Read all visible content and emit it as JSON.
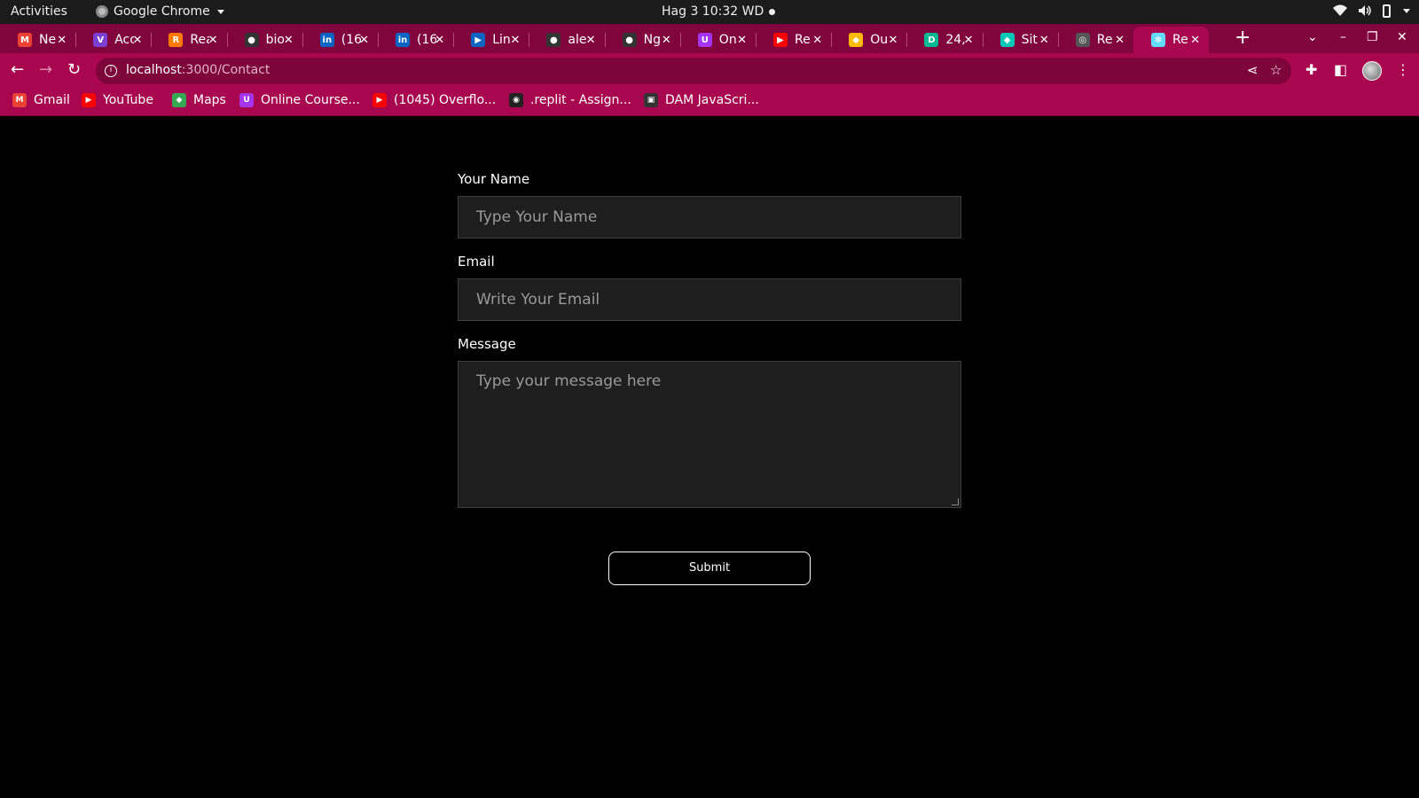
{
  "system_bar": {
    "activities": "Activities",
    "app_name": "Google Chrome",
    "clock": "Hag 3  10:32 WD"
  },
  "browser": {
    "tabs": [
      {
        "title": "Ne",
        "favicon": "gmail-icon",
        "color": "#ea4335",
        "glyph": "M"
      },
      {
        "title": "Acc",
        "favicon": "visual-studio-icon",
        "color": "#7b3fd1",
        "glyph": "V"
      },
      {
        "title": "Rea",
        "favicon": "codecademy-icon",
        "color": "#ff7a00",
        "glyph": "R"
      },
      {
        "title": "bio",
        "favicon": "github-icon",
        "color": "#333333",
        "glyph": "●"
      },
      {
        "title": "(16",
        "favicon": "linkedin-icon",
        "color": "#0a66c2",
        "glyph": "in"
      },
      {
        "title": "(16",
        "favicon": "linkedin-icon",
        "color": "#0a66c2",
        "glyph": "in"
      },
      {
        "title": "Lin",
        "favicon": "linkedin-learning-icon",
        "color": "#0a66c2",
        "glyph": "▶"
      },
      {
        "title": "ale",
        "favicon": "github-icon",
        "color": "#333333",
        "glyph": "●"
      },
      {
        "title": "Ng",
        "favicon": "github-icon",
        "color": "#333333",
        "glyph": "●"
      },
      {
        "title": "On",
        "favicon": "udemy-icon",
        "color": "#a435f0",
        "glyph": "U"
      },
      {
        "title": "Re",
        "favicon": "youtube-icon",
        "color": "#ff0000",
        "glyph": "▶"
      },
      {
        "title": "Ou",
        "favicon": "google-drive-icon",
        "color": "#fbbc04",
        "glyph": "◆"
      },
      {
        "title": "24,",
        "favicon": "d-icon",
        "color": "#00b894",
        "glyph": "D"
      },
      {
        "title": "Sit",
        "favicon": "netlify-icon",
        "color": "#00c7b7",
        "glyph": "◆"
      },
      {
        "title": "Re",
        "favicon": "globe-icon",
        "color": "#555555",
        "glyph": "◎"
      },
      {
        "title": "Re",
        "favicon": "react-icon",
        "color": "#61dafb",
        "glyph": "✻",
        "active": true
      }
    ],
    "url_host": "localhost",
    "url_path": ":3000/Contact",
    "bookmarks": [
      {
        "label": "Gmail",
        "favicon": "gmail-icon",
        "color": "#ea4335",
        "glyph": "M"
      },
      {
        "label": "YouTube",
        "favicon": "youtube-icon",
        "color": "#ff0000",
        "glyph": "▶"
      },
      {
        "label": "Maps",
        "favicon": "maps-icon",
        "color": "#34a853",
        "glyph": "◆"
      },
      {
        "label": "Online Course...",
        "favicon": "udemy-icon",
        "color": "#a435f0",
        "glyph": "U"
      },
      {
        "label": "(1045) Overflo...",
        "favicon": "youtube-icon",
        "color": "#ff0000",
        "glyph": "▶"
      },
      {
        "label": ".replit - Assign...",
        "favicon": "replit-icon",
        "color": "#222222",
        "glyph": "◉"
      },
      {
        "label": "DAM JavaScri...",
        "favicon": "contact-card-icon",
        "color": "#333333",
        "glyph": "▣"
      }
    ]
  },
  "form": {
    "name_label": "Your Name",
    "name_placeholder": "Type Your Name",
    "email_label": "Email",
    "email_placeholder": "Write Your Email",
    "message_label": "Message",
    "message_placeholder": "Type your message here",
    "submit_label": "Submit"
  }
}
